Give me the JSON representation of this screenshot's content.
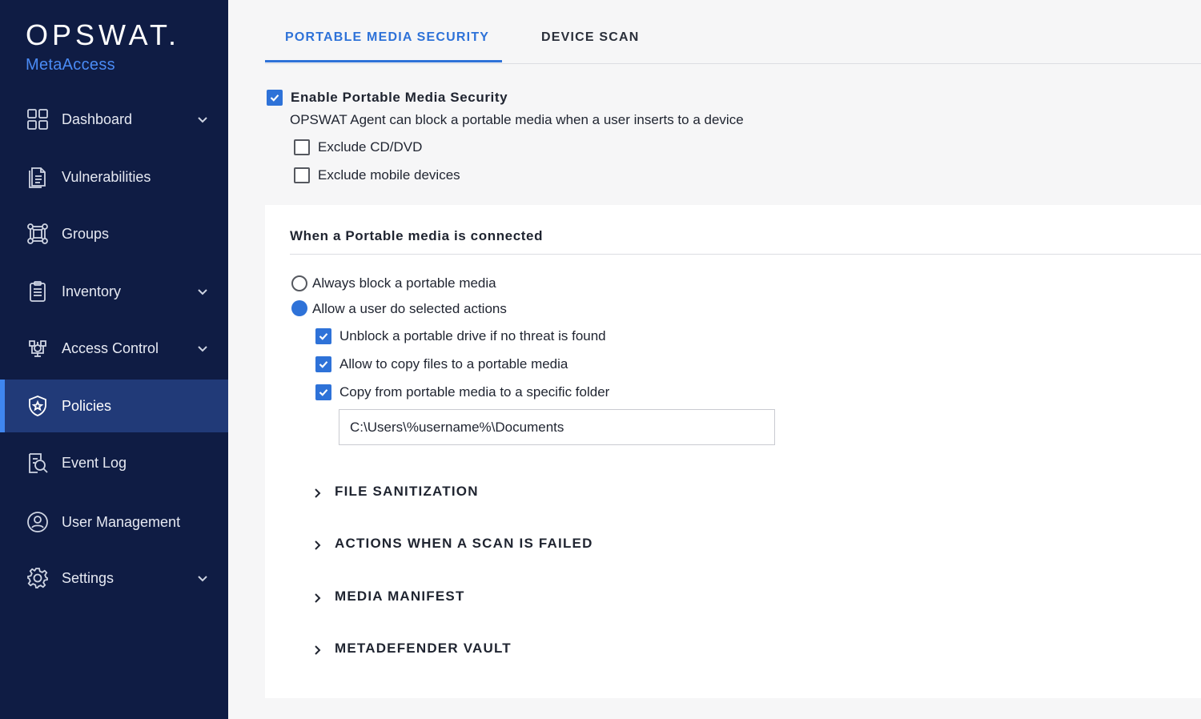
{
  "brand": {
    "name": "OPSWAT.",
    "product": "MetaAccess"
  },
  "sidebar": {
    "items": [
      {
        "label": "Dashboard",
        "icon": "dashboard-grid-icon",
        "has_submenu": true
      },
      {
        "label": "Vulnerabilities",
        "icon": "document-icon",
        "has_submenu": false
      },
      {
        "label": "Groups",
        "icon": "groups-network-icon",
        "has_submenu": false
      },
      {
        "label": "Inventory",
        "icon": "clipboard-icon",
        "has_submenu": true
      },
      {
        "label": "Access Control",
        "icon": "access-control-icon",
        "has_submenu": true
      },
      {
        "label": "Policies",
        "icon": "shield-icon",
        "has_submenu": false,
        "active": true
      },
      {
        "label": "Event Log",
        "icon": "event-log-search-icon",
        "has_submenu": false
      },
      {
        "label": "User Management",
        "icon": "user-circle-icon",
        "has_submenu": false
      },
      {
        "label": "Settings",
        "icon": "gear-icon",
        "has_submenu": true
      }
    ]
  },
  "tabs": [
    {
      "label": "PORTABLE MEDIA SECURITY",
      "active": true
    },
    {
      "label": "DEVICE SCAN",
      "active": false
    }
  ],
  "enable": {
    "label": "Enable Portable Media Security",
    "checked": true,
    "description": "OPSWAT Agent can block a portable media when a user inserts to a device",
    "exclusions": [
      {
        "label": "Exclude CD/DVD",
        "checked": false
      },
      {
        "label": "Exclude mobile devices",
        "checked": false
      }
    ]
  },
  "connected": {
    "title": "When a Portable media is connected",
    "options": [
      {
        "label": "Always block a portable media",
        "selected": false
      },
      {
        "label": "Allow a user do selected actions",
        "selected": true
      }
    ],
    "actions": [
      {
        "label": "Unblock a portable drive if no threat is found",
        "checked": true
      },
      {
        "label": "Allow to copy files to a portable media",
        "checked": true
      },
      {
        "label": "Copy from portable media to a specific folder",
        "checked": true
      }
    ],
    "folder_path": "C:\\Users\\%username%\\Documents"
  },
  "sections": [
    {
      "label": "FILE SANITIZATION"
    },
    {
      "label": "ACTIONS WHEN A SCAN IS FAILED"
    },
    {
      "label": "MEDIA MANIFEST"
    },
    {
      "label": "METADEFENDER VAULT"
    }
  ],
  "colors": {
    "sidebar_bg": "#0f1c44",
    "sidebar_active_bg": "#213a78",
    "accent": "#2e72d8",
    "brand_sub": "#4a8bf5"
  }
}
